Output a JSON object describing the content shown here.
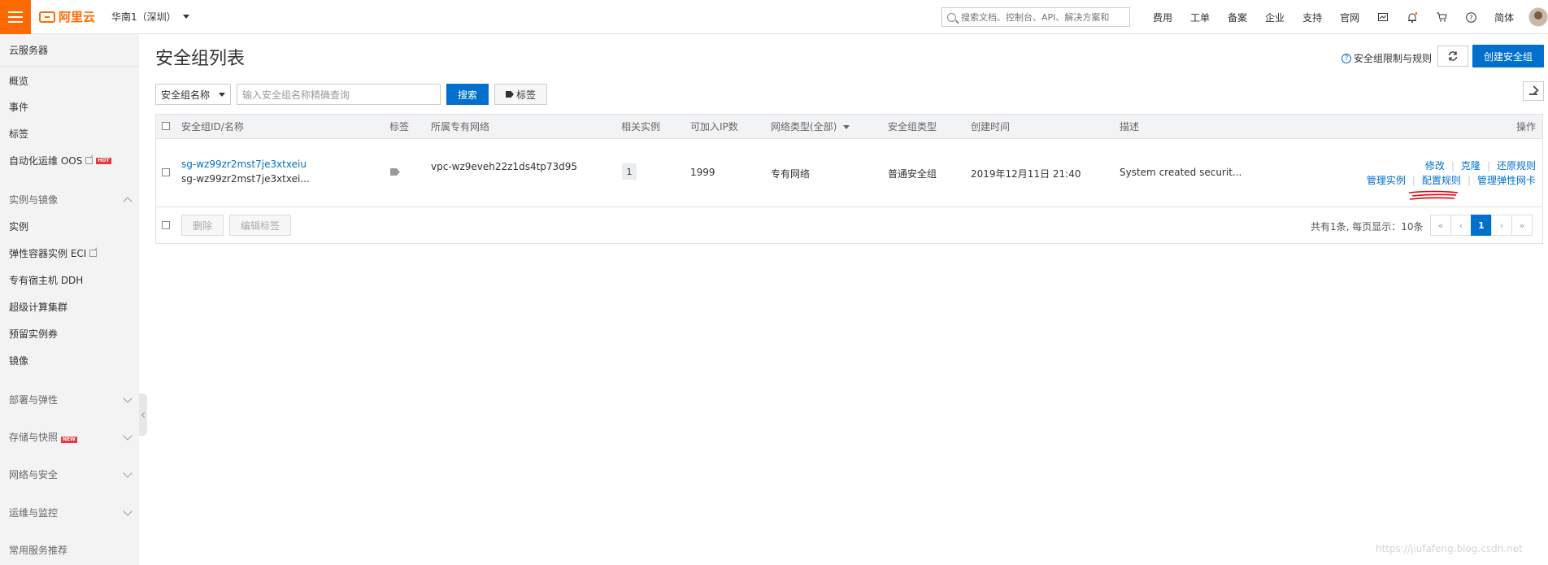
{
  "topbar": {
    "logo_text": "阿里云",
    "region": "华南1（深圳）",
    "search_placeholder": "搜索文档、控制台、API、解决方案和",
    "nav": [
      "费用",
      "工单",
      "备案",
      "企业",
      "支持",
      "官网"
    ],
    "lang": "简体",
    "icons": [
      "message-icon",
      "bell-icon",
      "cart-icon",
      "help-icon"
    ]
  },
  "sidebar": {
    "header": "云服务器",
    "items": [
      "概览",
      "事件",
      "标签",
      "自动化运维 OOS"
    ],
    "oos_badge": "HOT",
    "group_instances": "实例与镜像",
    "instance_items": [
      "实例",
      "弹性容器实例 ECI",
      "专有宿主机 DDH",
      "超级计算集群",
      "预留实例券",
      "镜像"
    ],
    "groups": [
      "部署与弹性",
      "存储与快照",
      "网络与安全",
      "运维与监控"
    ],
    "storage_badge": "NEW",
    "footer": "常用服务推荐"
  },
  "main": {
    "title": "安全组列表",
    "limits_link": "安全组限制与规则",
    "create_button": "创建安全组",
    "filter_select": "安全组名称",
    "filter_placeholder": "输入安全组名称精确查询",
    "search_button": "搜索",
    "tag_button": "标签"
  },
  "table": {
    "headers": {
      "id_name": "安全组ID/名称",
      "tags": "标签",
      "vpc": "所属专有网络",
      "instances": "相关实例",
      "ip_count": "可加入IP数",
      "network_type": "网络类型(全部)",
      "sg_type": "安全组类型",
      "created": "创建时间",
      "description": "描述",
      "actions": "操作"
    },
    "rows": [
      {
        "id": "sg-wz99zr2mst7je3xtxeiu",
        "name": "sg-wz99zr2mst7je3xtxei...",
        "vpc": "vpc-wz9eveh22z1ds4tp73d95",
        "instances": "1",
        "ip_count": "1999",
        "network_type": "专有网络",
        "sg_type": "普通安全组",
        "created": "2019年12月11日 21:40",
        "description": "System created securit...",
        "actions_row1": [
          "修改",
          "克隆",
          "还原规则"
        ],
        "actions_row2": [
          "管理实例",
          "配置规则",
          "管理弹性网卡"
        ]
      }
    ],
    "footer": {
      "delete": "删除",
      "edit_tags": "编辑标签",
      "summary": "共有1条, 每页显示：10条",
      "pages": [
        "«",
        "‹",
        "1",
        "›",
        "»"
      ]
    }
  },
  "watermark": "https://jiufafeng.blog.csdn.net",
  "colors": {
    "brand": "#ff6a00",
    "primary": "#0070cc",
    "annotation": "#e60012"
  }
}
